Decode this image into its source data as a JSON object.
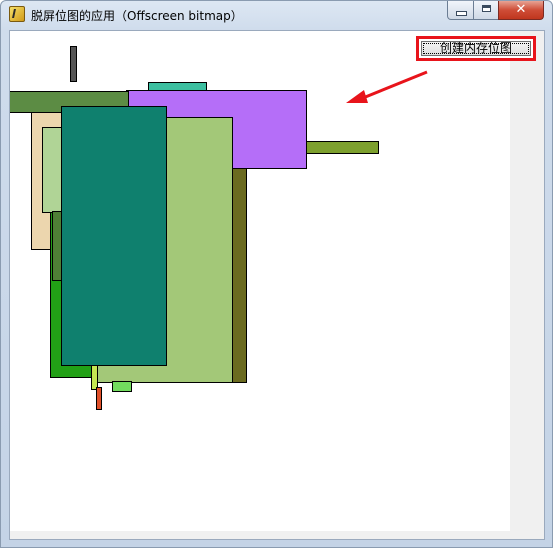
{
  "window": {
    "title": "脱屏位图的应用（Offscreen bitmap）",
    "icon": "app-icon",
    "controls": {
      "minimize_icon": "minimize-icon",
      "maximize_icon": "maximize-icon",
      "close_icon": "close-icon",
      "close_glyph": "✕"
    }
  },
  "toolbar": {
    "create_label": "创建内存位图"
  },
  "annotation": {
    "color": "#e8141b",
    "arrow_icon": "arrow-icon"
  },
  "drawing": {
    "background": "#ffffff",
    "rectangles": [
      {
        "name": "rect-dark-gray-bar",
        "color": "#555555"
      },
      {
        "name": "rect-teal-small",
        "color": "#3cbfa0"
      },
      {
        "name": "rect-olive-bar",
        "color": "#7da02e"
      },
      {
        "name": "rect-purple",
        "color": "#b56ef8"
      },
      {
        "name": "rect-tan",
        "color": "#ecd6ae"
      },
      {
        "name": "rect-olive-dark",
        "color": "#6b6b20"
      },
      {
        "name": "rect-green",
        "color": "#22a016"
      },
      {
        "name": "rect-light-green",
        "color": "#a3c878"
      },
      {
        "name": "rect-pale-green",
        "color": "#b0d496"
      },
      {
        "name": "rect-moss-small",
        "color": "#4f7f36"
      },
      {
        "name": "rect-mint-small",
        "color": "#72dc5e"
      },
      {
        "name": "rect-lime-strip",
        "color": "#c4e652"
      },
      {
        "name": "rect-orange-strip",
        "color": "#e0502a"
      },
      {
        "name": "rect-moss-top",
        "color": "#5c8c44"
      },
      {
        "name": "rect-teal-large",
        "color": "#0f806e"
      }
    ]
  }
}
